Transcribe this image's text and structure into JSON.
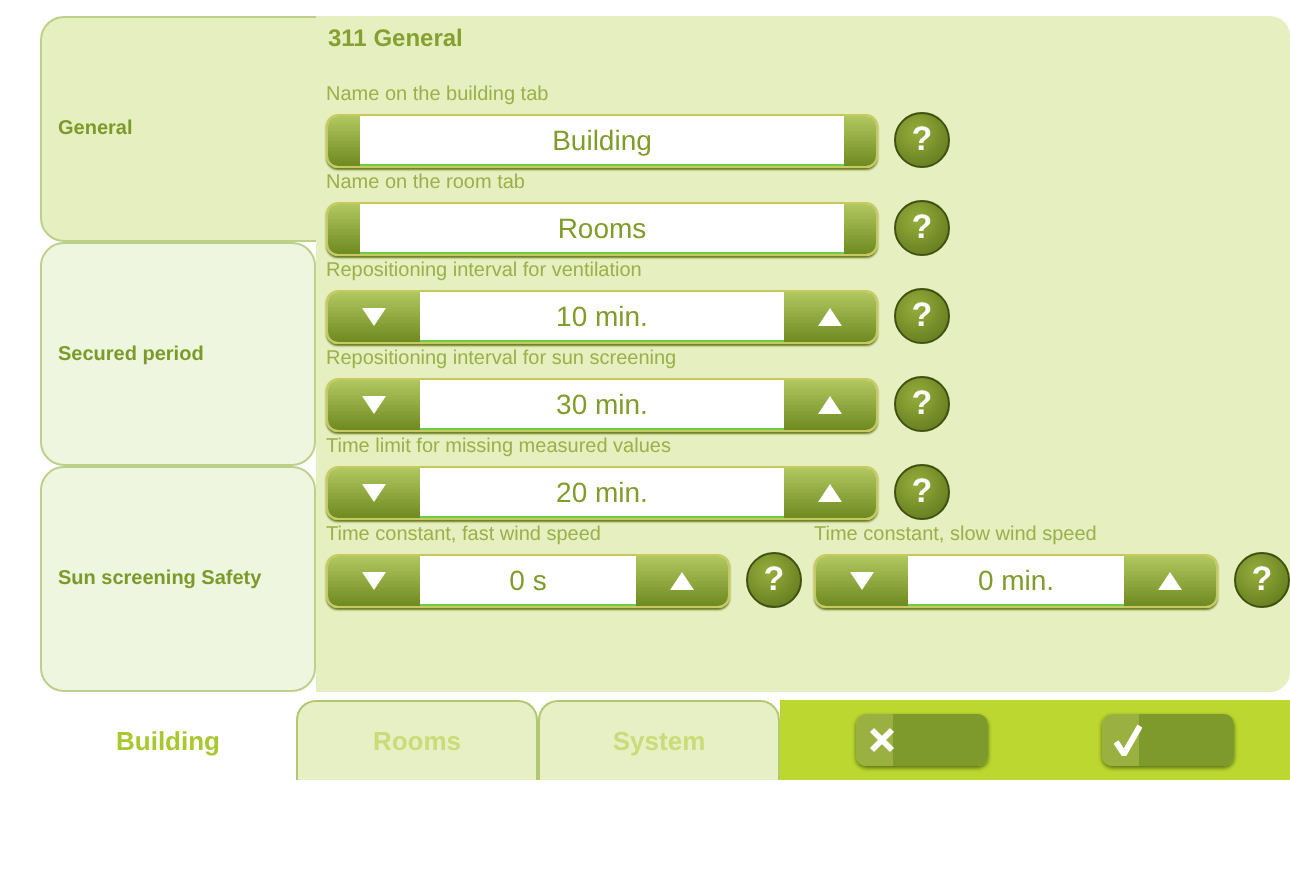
{
  "header": "311 General",
  "sections": [
    {
      "label": "General",
      "selected": true
    },
    {
      "label": "Secured period",
      "selected": false
    },
    {
      "label": "Sun screening Safety",
      "selected": false
    }
  ],
  "rows": [
    [
      {
        "kind": "text",
        "label": "Name on the building tab",
        "value": "Building",
        "help": "?"
      }
    ],
    [
      {
        "kind": "text",
        "label": "Name on the room tab",
        "value": "Rooms",
        "help": "?"
      }
    ],
    [
      {
        "kind": "spinner",
        "label": "Repositioning interval for ventilation",
        "value": "10 min.",
        "help": "?"
      }
    ],
    [
      {
        "kind": "spinner",
        "label": "Repositioning interval for sun screening",
        "value": "30 min.",
        "help": "?"
      }
    ],
    [
      {
        "kind": "spinner",
        "label": "Time limit for missing measured values",
        "value": "20 min.",
        "help": "?"
      }
    ],
    [
      {
        "kind": "spinner",
        "label": "Time constant, fast wind speed",
        "value": "0 s",
        "help": "?"
      },
      {
        "kind": "spinner",
        "label": "Time constant, slow wind speed",
        "value": "0 min.",
        "help": "?"
      }
    ]
  ],
  "tabs": [
    {
      "label": "Building",
      "selected": true
    },
    {
      "label": "Rooms",
      "selected": false
    },
    {
      "label": "System",
      "selected": false
    }
  ]
}
